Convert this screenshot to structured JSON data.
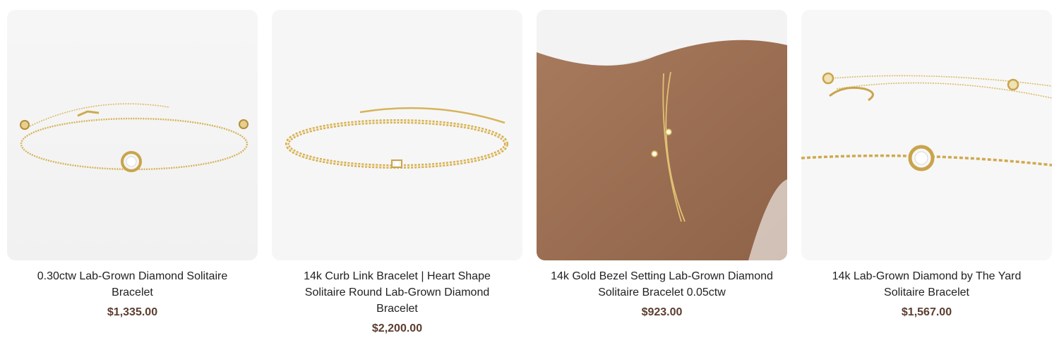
{
  "colors": {
    "price": "#5b3d2e",
    "title": "#222222",
    "gold": "#d8b75f",
    "thumb_bg": "#f5f5f5"
  },
  "products": [
    {
      "image_icon": "yellow-gold-bracelet-three-bezel-diamonds",
      "title": "0.30ctw Lab-Grown Diamond Solitaire Bracelet",
      "price": "$1,335.00"
    },
    {
      "image_icon": "curb-link-bracelet-center-diamond",
      "title": "14k Curb Link Bracelet | Heart Shape Solitaire Round Lab-Grown Diamond Bracelet",
      "price": "$2,200.00"
    },
    {
      "image_icon": "double-chain-bracelet-on-wrist",
      "title": "14k Gold Bezel Setting Lab-Grown Diamond Solitaire Bracelet 0.05ctw",
      "price": "$923.00"
    },
    {
      "image_icon": "diamond-by-the-yard-bracelet-closeup",
      "title": "14k Lab-Grown Diamond by The Yard Solitaire Bracelet",
      "price": "$1,567.00"
    }
  ]
}
